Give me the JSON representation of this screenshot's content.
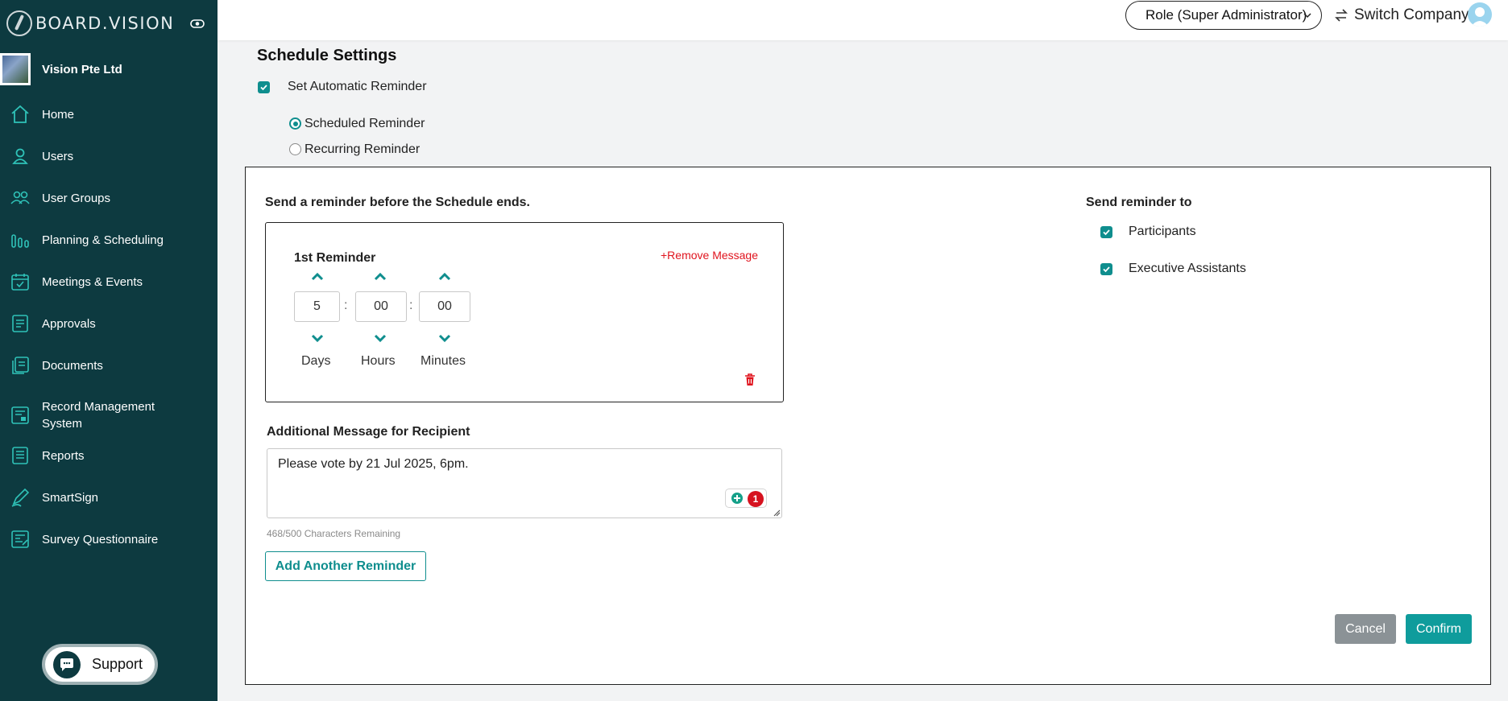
{
  "sidebar": {
    "brand": "BOARD.VISION",
    "company_name": "Vision Pte Ltd",
    "items": [
      {
        "label": "Home",
        "icon": "home-icon"
      },
      {
        "label": "Users",
        "icon": "user-icon"
      },
      {
        "label": "User Groups",
        "icon": "users-icon"
      },
      {
        "label": "Planning & Scheduling",
        "icon": "bar-chart-icon"
      },
      {
        "label": "Meetings & Events",
        "icon": "calendar-icon"
      },
      {
        "label": "Approvals",
        "icon": "approval-document-icon"
      },
      {
        "label": "Documents",
        "icon": "documents-icon"
      },
      {
        "label": "Record Management\nSystem",
        "icon": "record-management-icon"
      },
      {
        "label": "Reports",
        "icon": "reports-icon"
      },
      {
        "label": "SmartSign",
        "icon": "pen-icon"
      },
      {
        "label": "Survey Questionnaire",
        "icon": "survey-icon"
      }
    ],
    "support_label": "Support"
  },
  "topbar": {
    "role": "Role (Super Administrator)",
    "switch_company": "Switch Company"
  },
  "schedule": {
    "title": "Schedule Settings",
    "auto_reminder": {
      "label": "Set Automatic Reminder",
      "checked": true
    },
    "reminder_types": [
      {
        "label": "Scheduled Reminder",
        "selected": true
      },
      {
        "label": "Recurring Reminder",
        "selected": false
      }
    ]
  },
  "panel": {
    "before_end_heading": "Send a reminder before the Schedule ends.",
    "reminder": {
      "title": "1st Reminder",
      "remove_label": "+Remove Message",
      "days": "5",
      "hours": "00",
      "minutes": "00",
      "separator": ":",
      "units": {
        "days": "Days",
        "hours": "Hours",
        "minutes": "Minutes"
      }
    },
    "message_label": "Additional Message for Recipient",
    "message_value": "Please vote by 21 Jul 2025, 6pm.",
    "grammar_issue_count": "1",
    "char_remaining": "468/500 Characters Remaining",
    "add_reminder_label": "Add Another Reminder",
    "send_to_heading": "Send reminder to",
    "recipients": [
      {
        "label": "Participants",
        "checked": true
      },
      {
        "label": "Executive Assistants",
        "checked": true
      }
    ],
    "cancel_label": "Cancel",
    "confirm_label": "Confirm"
  },
  "colors": {
    "sidebar_bg": "#0d3a40",
    "accent": "#0f8e8e",
    "danger": "#e0141e",
    "cancel_bg": "#8b9296"
  }
}
